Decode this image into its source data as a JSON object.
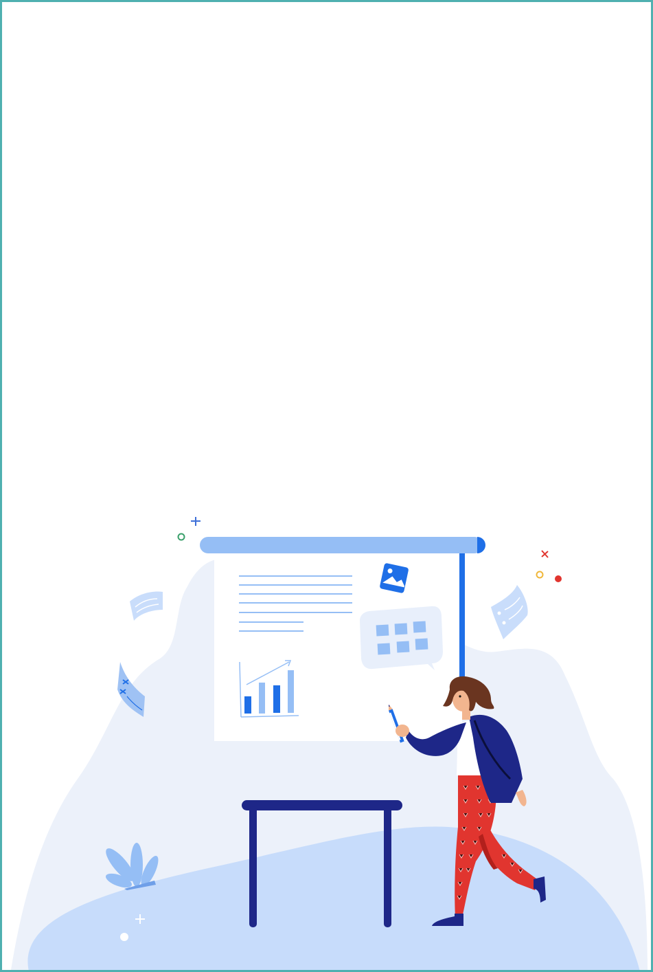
{
  "page": {
    "frame_border_color": "#4fb0b0",
    "background_color": "#ffffff"
  },
  "illustration": {
    "subject": "presenter-at-whiteboard",
    "icons": [
      "image-icon",
      "grid-icon",
      "bar-chart-icon",
      "pencil-icon",
      "plant-icon",
      "paper-icon",
      "sparkle-icon"
    ],
    "palette": {
      "blob_light": "#ecf1fa",
      "blob_mid": "#c7dcfb",
      "board_rail": "#95bef5",
      "accent_blue": "#1f6fe7",
      "navy": "#1e2788",
      "red": "#e1352f",
      "skin": "#f2b58f",
      "hair": "#6a3520"
    }
  }
}
